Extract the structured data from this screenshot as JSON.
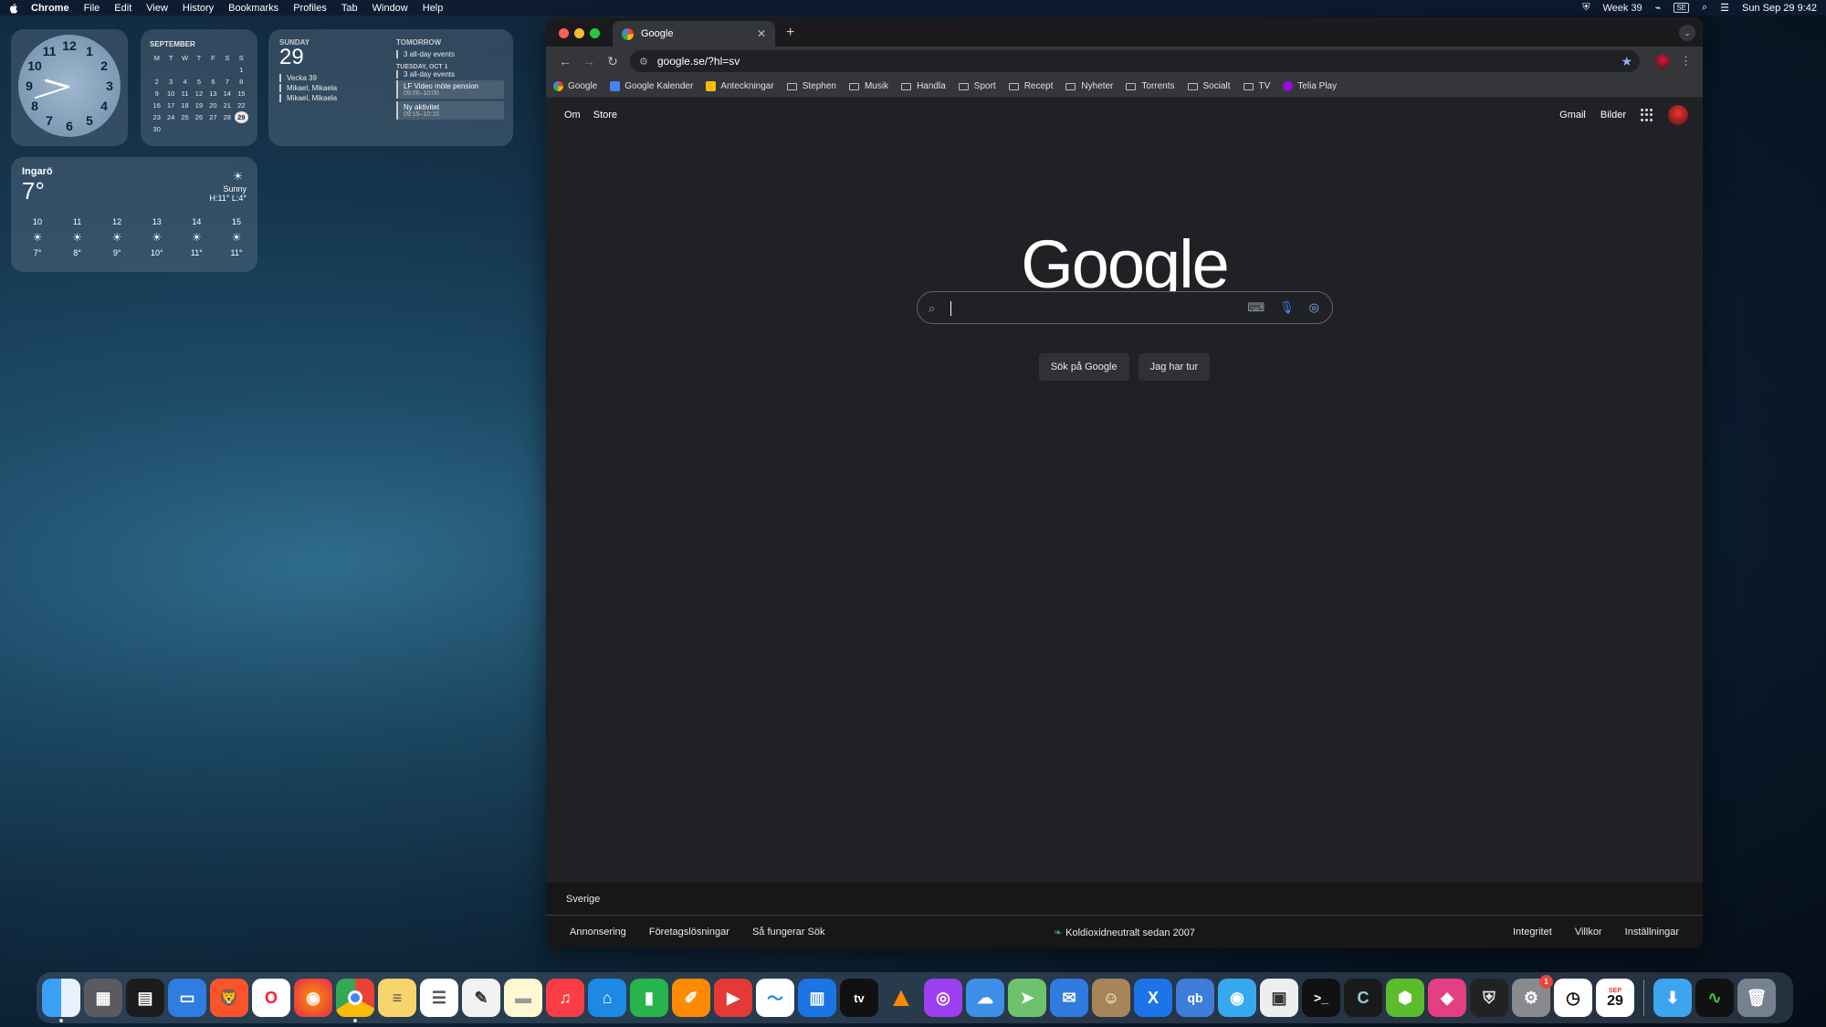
{
  "menubar": {
    "app": "Chrome",
    "items": [
      "File",
      "Edit",
      "View",
      "History",
      "Bookmarks",
      "Profiles",
      "Tab",
      "Window",
      "Help"
    ],
    "week": "Week 39",
    "input_source": "SE",
    "datetime": "Sun Sep 29  9:42"
  },
  "calendar_widget": {
    "month": "SEPTEMBER",
    "weekdays": [
      "M",
      "T",
      "W",
      "T",
      "F",
      "S",
      "S"
    ],
    "weeks": [
      [
        "",
        "",
        "",
        "",
        "",
        "",
        "1"
      ],
      [
        "2",
        "3",
        "4",
        "5",
        "6",
        "7",
        "8"
      ],
      [
        "9",
        "10",
        "11",
        "12",
        "13",
        "14",
        "15"
      ],
      [
        "16",
        "17",
        "18",
        "19",
        "20",
        "21",
        "22"
      ],
      [
        "23",
        "24",
        "25",
        "26",
        "27",
        "28",
        "29"
      ],
      [
        "30",
        "",
        "",
        "",
        "",
        "",
        ""
      ]
    ],
    "today": "29"
  },
  "events_widget": {
    "day_label": "SUNDAY",
    "day_num": "29",
    "today_events": [
      "Vecka 39",
      "Mikael, Mikaela",
      "Mikael, Mikaela"
    ],
    "tomorrow_label": "TOMORROW",
    "tomorrow_allday": "3 all-day events",
    "next_label": "TUESDAY, OCT 1",
    "next_allday": "3 all-day events",
    "ev1_title": "LF Video möte pension",
    "ev1_time": "09:00–10:00",
    "ev2_title": "Ny aktivitet",
    "ev2_time": "09:15–10:15"
  },
  "weather_widget": {
    "city": "Ingarö",
    "temp": "7°",
    "condition": "Sunny",
    "hilo": "H:11° L:4°",
    "hours": [
      {
        "h": "10",
        "t": "7°"
      },
      {
        "h": "11",
        "t": "8°"
      },
      {
        "h": "12",
        "t": "9°"
      },
      {
        "h": "13",
        "t": "10°"
      },
      {
        "h": "14",
        "t": "11°"
      },
      {
        "h": "15",
        "t": "11°"
      }
    ]
  },
  "browser": {
    "tab_title": "Google",
    "url": "google.se/?hl=sv",
    "bookmarks": [
      "Google",
      "Google Kalender",
      "Anteckningar",
      "Stephen",
      "Musik",
      "Handla",
      "Sport",
      "Recept",
      "Nyheter",
      "Torrents",
      "Socialt",
      "TV",
      "Telia Play"
    ]
  },
  "google": {
    "nav_about": "Om",
    "nav_store": "Store",
    "gmail": "Gmail",
    "images": "Bilder",
    "logo": "Google",
    "search_placeholder": "",
    "btn_search": "Sök på Google",
    "btn_lucky": "Jag har tur",
    "country": "Sverige",
    "footer_left": [
      "Annonsering",
      "Företagslösningar",
      "Så fungerar Sök"
    ],
    "footer_center": "Koldioxidneutralt sedan 2007",
    "footer_right": [
      "Integritet",
      "Villkor",
      "Inställningar"
    ]
  },
  "dock": {
    "calendar_badge_month": "SEP",
    "calendar_badge_day": "29",
    "settings_badge": "1",
    "appletv_label": "tv"
  },
  "colors": {
    "chrome_dark": "#202124",
    "toolbar": "#35363a",
    "accent_blue": "#8ab4f8"
  }
}
